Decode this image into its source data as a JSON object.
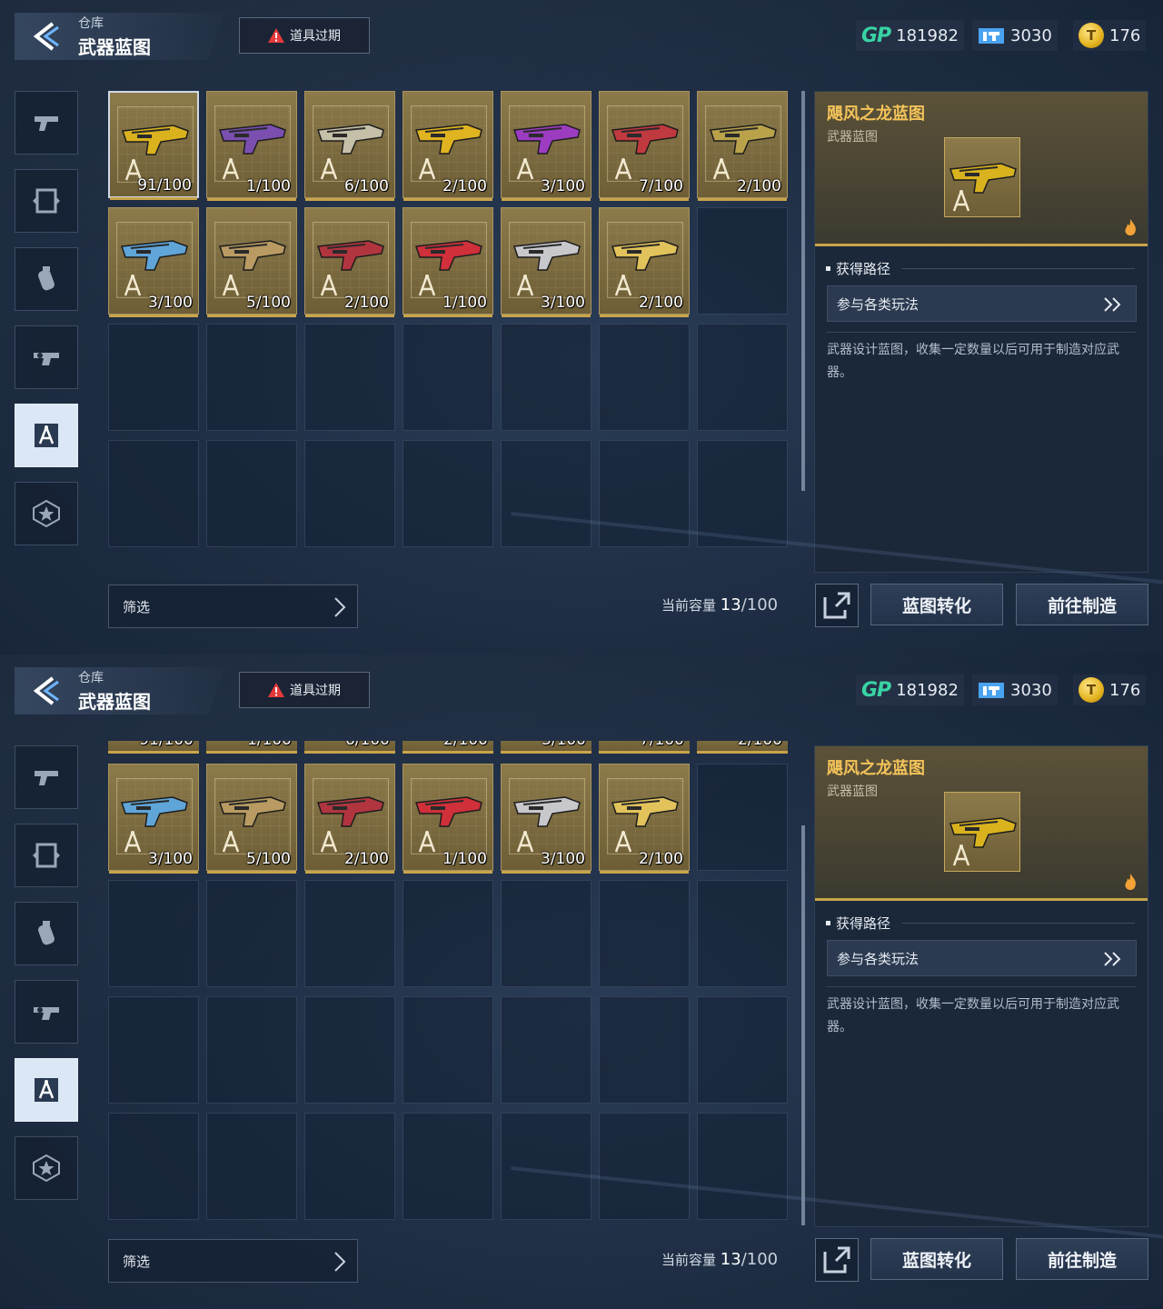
{
  "header": {
    "breadcrumb": "仓库",
    "title": "武器蓝图",
    "expire_button": "道具过期"
  },
  "currency": {
    "gp_label": "GP",
    "gp": "181982",
    "tickets": "3030",
    "coins": "176"
  },
  "nav": {
    "items": [
      "pistol-icon",
      "frame-icon",
      "grenade-icon",
      "weapon-mod-icon",
      "blueprint-icon",
      "star-badge-icon"
    ],
    "active_index": 4
  },
  "inventory": {
    "items": [
      {
        "count": "91/100",
        "color": "#d9b21e"
      },
      {
        "count": "1/100",
        "color": "#7a4fb0"
      },
      {
        "count": "6/100",
        "color": "#c6c0a8"
      },
      {
        "count": "2/100",
        "color": "#e0b320"
      },
      {
        "count": "3/100",
        "color": "#9c3cc0"
      },
      {
        "count": "7/100",
        "color": "#c0393f"
      },
      {
        "count": "2/100",
        "color": "#b9a24a"
      },
      {
        "count": "3/100",
        "color": "#5fa5d8"
      },
      {
        "count": "5/100",
        "color": "#b89a62"
      },
      {
        "count": "2/100",
        "color": "#b0353f"
      },
      {
        "count": "1/100",
        "color": "#d0303a"
      },
      {
        "count": "3/100",
        "color": "#c8c8cc"
      },
      {
        "count": "2/100",
        "color": "#e2c25a"
      }
    ],
    "selected_index": 0
  },
  "bottom": {
    "filter_label": "筛选",
    "capacity_label": "当前容量",
    "capacity_current": "13",
    "capacity_total": "/100"
  },
  "detail": {
    "name": "飓风之龙蓝图",
    "type": "武器蓝图",
    "source_title": "获得路径",
    "source_button": "参与各类玩法",
    "description": "武器设计蓝图，收集一定数量以后可用于制造对应武器。"
  },
  "actions": {
    "convert": "蓝图转化",
    "craft": "前往制造"
  }
}
